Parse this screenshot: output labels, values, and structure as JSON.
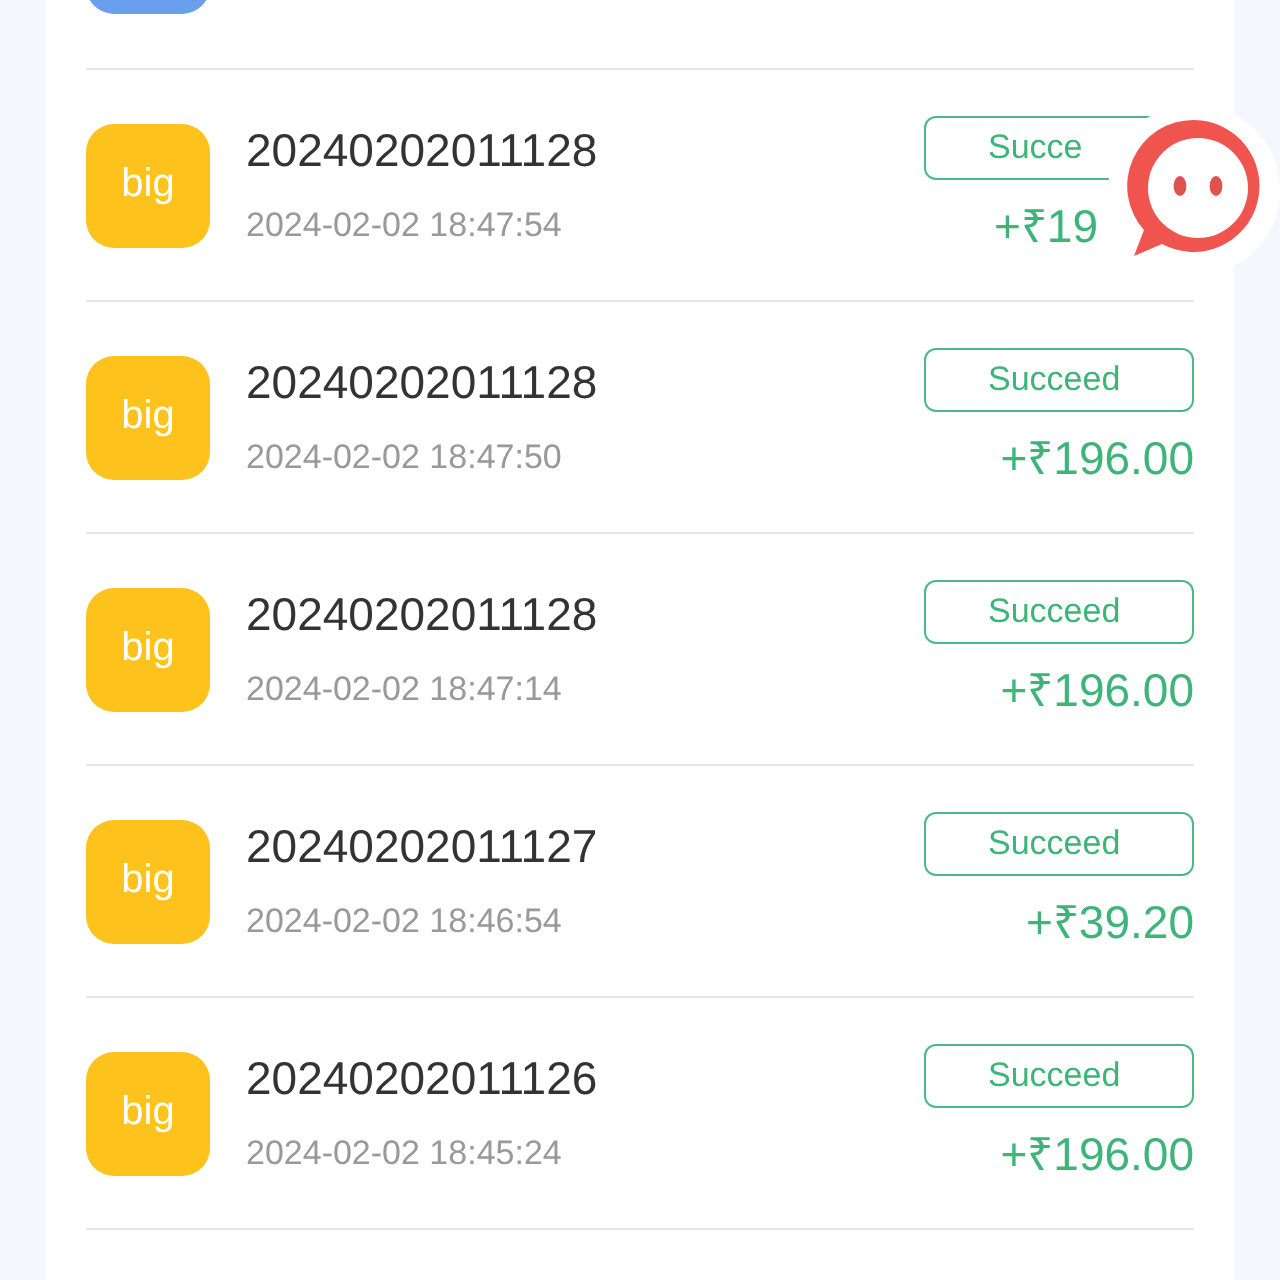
{
  "top_row": {
    "color": "#6a9ff0"
  },
  "records": [
    {
      "icon": "big",
      "color": "#fdc21b",
      "number": "20240202011128",
      "time": "2024-02-02 18:47:54",
      "status": "Succe",
      "amount": "+₹19",
      "partly_hidden": true
    },
    {
      "icon": "big",
      "color": "#fdc21b",
      "number": "20240202011128",
      "time": "2024-02-02 18:47:50",
      "status": "Succeed",
      "amount": "+₹196.00",
      "partly_hidden": false
    },
    {
      "icon": "big",
      "color": "#fdc21b",
      "number": "20240202011128",
      "time": "2024-02-02 18:47:14",
      "status": "Succeed",
      "amount": "+₹196.00",
      "partly_hidden": false
    },
    {
      "icon": "big",
      "color": "#fdc21b",
      "number": "20240202011127",
      "time": "2024-02-02 18:46:54",
      "status": "Succeed",
      "amount": "+₹39.20",
      "partly_hidden": false
    },
    {
      "icon": "big",
      "color": "#fdc21b",
      "number": "20240202011126",
      "time": "2024-02-02 18:45:24",
      "status": "Succeed",
      "amount": "+₹196.00",
      "partly_hidden": false
    }
  ]
}
